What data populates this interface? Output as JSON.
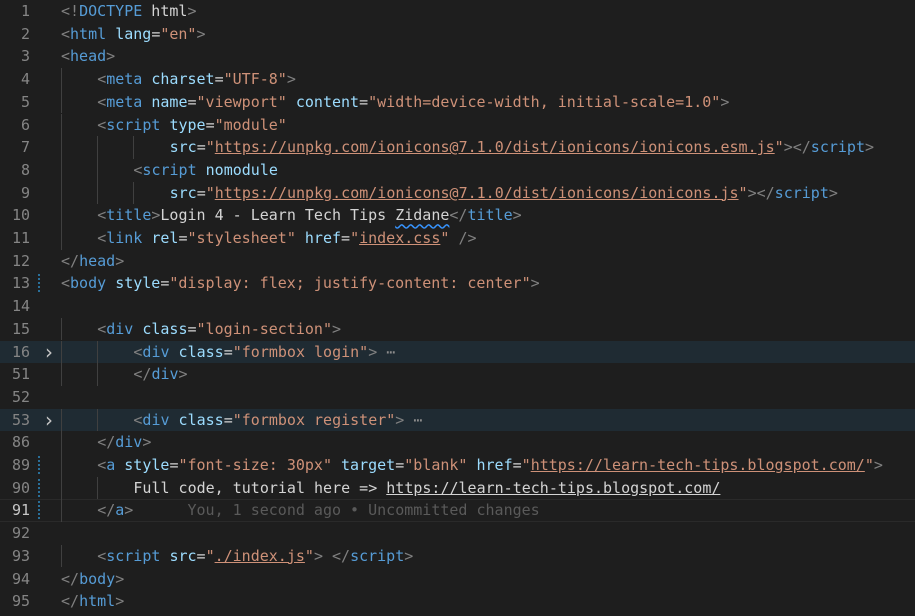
{
  "editor": {
    "lines": [
      {
        "n": "1",
        "indent": 0,
        "tokens": [
          [
            "bracket",
            "<!"
          ],
          [
            "tag",
            "DOCTYPE"
          ],
          [
            "text",
            " html"
          ],
          [
            "bracket",
            ">"
          ]
        ]
      },
      {
        "n": "2",
        "indent": 0,
        "tokens": [
          [
            "bracket",
            "<"
          ],
          [
            "tag",
            "html"
          ],
          [
            "text",
            " "
          ],
          [
            "attr",
            "lang"
          ],
          [
            "text",
            "="
          ],
          [
            "str",
            "\"en\""
          ],
          [
            "bracket",
            ">"
          ]
        ]
      },
      {
        "n": "3",
        "indent": 0,
        "tokens": [
          [
            "bracket",
            "<"
          ],
          [
            "tag",
            "head"
          ],
          [
            "bracket",
            ">"
          ]
        ]
      },
      {
        "n": "4",
        "indent": 1,
        "tokens": [
          [
            "bracket",
            "<"
          ],
          [
            "tag",
            "meta"
          ],
          [
            "text",
            " "
          ],
          [
            "attr",
            "charset"
          ],
          [
            "text",
            "="
          ],
          [
            "str",
            "\"UTF-8\""
          ],
          [
            "bracket",
            ">"
          ]
        ]
      },
      {
        "n": "5",
        "indent": 1,
        "tokens": [
          [
            "bracket",
            "<"
          ],
          [
            "tag",
            "meta"
          ],
          [
            "text",
            " "
          ],
          [
            "attr",
            "name"
          ],
          [
            "text",
            "="
          ],
          [
            "str",
            "\"viewport\""
          ],
          [
            "text",
            " "
          ],
          [
            "attr",
            "content"
          ],
          [
            "text",
            "="
          ],
          [
            "str",
            "\"width=device-width, initial-scale=1.0\""
          ],
          [
            "bracket",
            ">"
          ]
        ]
      },
      {
        "n": "6",
        "indent": 1,
        "tokens": [
          [
            "bracket",
            "<"
          ],
          [
            "tag",
            "script"
          ],
          [
            "text",
            " "
          ],
          [
            "attr",
            "type"
          ],
          [
            "text",
            "="
          ],
          [
            "str",
            "\"module\""
          ]
        ]
      },
      {
        "n": "7",
        "indent": 3,
        "tokens": [
          [
            "attr",
            "src"
          ],
          [
            "text",
            "="
          ],
          [
            "str",
            "\""
          ],
          [
            "str-link",
            "https://unpkg.com/ionicons@7.1.0/dist/ionicons/ionicons.esm.js"
          ],
          [
            "str",
            "\""
          ],
          [
            "bracket",
            "></"
          ],
          [
            "tag",
            "script"
          ],
          [
            "bracket",
            ">"
          ]
        ]
      },
      {
        "n": "8",
        "indent": 2,
        "tokens": [
          [
            "bracket",
            "<"
          ],
          [
            "tag",
            "script"
          ],
          [
            "text",
            " "
          ],
          [
            "attr",
            "nomodule"
          ]
        ]
      },
      {
        "n": "9",
        "indent": 3,
        "tokens": [
          [
            "attr",
            "src"
          ],
          [
            "text",
            "="
          ],
          [
            "str",
            "\""
          ],
          [
            "str-link",
            "https://unpkg.com/ionicons@7.1.0/dist/ionicons/ionicons.js"
          ],
          [
            "str",
            "\""
          ],
          [
            "bracket",
            "></"
          ],
          [
            "tag",
            "script"
          ],
          [
            "bracket",
            ">"
          ]
        ]
      },
      {
        "n": "10",
        "indent": 1,
        "tokens": [
          [
            "bracket",
            "<"
          ],
          [
            "tag",
            "title"
          ],
          [
            "bracket",
            ">"
          ],
          [
            "text",
            "Login 4 - Learn Tech Tips "
          ],
          [
            "text-squiggle",
            "Zidane"
          ],
          [
            "bracket",
            "</"
          ],
          [
            "tag",
            "title"
          ],
          [
            "bracket",
            ">"
          ]
        ]
      },
      {
        "n": "11",
        "indent": 1,
        "tokens": [
          [
            "bracket",
            "<"
          ],
          [
            "tag",
            "link"
          ],
          [
            "text",
            " "
          ],
          [
            "attr",
            "rel"
          ],
          [
            "text",
            "="
          ],
          [
            "str",
            "\"stylesheet\""
          ],
          [
            "text",
            " "
          ],
          [
            "attr",
            "href"
          ],
          [
            "text",
            "="
          ],
          [
            "str",
            "\""
          ],
          [
            "str-link",
            "index.css"
          ],
          [
            "str",
            "\""
          ],
          [
            "text",
            " "
          ],
          [
            "bracket",
            "/>"
          ]
        ]
      },
      {
        "n": "12",
        "indent": 0,
        "tokens": [
          [
            "bracket",
            "</"
          ],
          [
            "tag",
            "head"
          ],
          [
            "bracket",
            ">"
          ]
        ]
      },
      {
        "n": "13",
        "indent": 0,
        "tokens": [
          [
            "bracket",
            "<"
          ],
          [
            "tag",
            "body"
          ],
          [
            "text",
            " "
          ],
          [
            "attr",
            "style"
          ],
          [
            "text",
            "="
          ],
          [
            "str",
            "\"display: flex; justify-content: center\""
          ],
          [
            "bracket",
            ">"
          ]
        ]
      },
      {
        "n": "14",
        "indent": 0,
        "tokens": []
      },
      {
        "n": "15",
        "indent": 1,
        "tokens": [
          [
            "bracket",
            "<"
          ],
          [
            "tag",
            "div"
          ],
          [
            "text",
            " "
          ],
          [
            "attr",
            "class"
          ],
          [
            "text",
            "="
          ],
          [
            "str",
            "\"login-section\""
          ],
          [
            "bracket",
            ">"
          ]
        ]
      },
      {
        "n": "16",
        "indent": 2,
        "tokens": [
          [
            "bracket",
            "<"
          ],
          [
            "tag",
            "div"
          ],
          [
            "text",
            " "
          ],
          [
            "attr",
            "class"
          ],
          [
            "text",
            "="
          ],
          [
            "str",
            "\"formbox login\""
          ],
          [
            "bracket",
            ">"
          ],
          [
            "fold",
            " ⋯"
          ]
        ]
      },
      {
        "n": "51",
        "indent": 2,
        "tokens": [
          [
            "bracket",
            "</"
          ],
          [
            "tag",
            "div"
          ],
          [
            "bracket",
            ">"
          ]
        ]
      },
      {
        "n": "52",
        "indent": 0,
        "tokens": []
      },
      {
        "n": "53",
        "indent": 2,
        "tokens": [
          [
            "bracket",
            "<"
          ],
          [
            "tag",
            "div"
          ],
          [
            "text",
            " "
          ],
          [
            "attr",
            "class"
          ],
          [
            "text",
            "="
          ],
          [
            "str",
            "\"formbox register\""
          ],
          [
            "bracket",
            ">"
          ],
          [
            "fold",
            " ⋯"
          ]
        ]
      },
      {
        "n": "86",
        "indent": 1,
        "tokens": [
          [
            "bracket",
            "</"
          ],
          [
            "tag",
            "div"
          ],
          [
            "bracket",
            ">"
          ]
        ]
      },
      {
        "n": "89",
        "indent": 1,
        "tokens": [
          [
            "bracket",
            "<"
          ],
          [
            "tag",
            "a"
          ],
          [
            "text",
            " "
          ],
          [
            "attr",
            "style"
          ],
          [
            "text",
            "="
          ],
          [
            "str",
            "\"font-size: 30px\""
          ],
          [
            "text",
            " "
          ],
          [
            "attr",
            "target"
          ],
          [
            "text",
            "="
          ],
          [
            "str",
            "\"blank\""
          ],
          [
            "text",
            " "
          ],
          [
            "attr",
            "href"
          ],
          [
            "text",
            "="
          ],
          [
            "str",
            "\""
          ],
          [
            "str-link",
            "https://learn-tech-tips.blogspot.com/"
          ],
          [
            "str",
            "\""
          ],
          [
            "bracket",
            ">"
          ]
        ]
      },
      {
        "n": "90",
        "indent": 2,
        "tokens": [
          [
            "text",
            "Full code, tutorial here => "
          ],
          [
            "text-link",
            "https://learn-tech-tips.blogspot.com/"
          ]
        ]
      },
      {
        "n": "91",
        "indent": 1,
        "tokens": [
          [
            "bracket",
            "</"
          ],
          [
            "tag",
            "a"
          ],
          [
            "bracket",
            ">"
          ],
          [
            "text",
            "    "
          ],
          [
            "blame",
            "  You, 1 second ago • Uncommitted changes"
          ]
        ]
      },
      {
        "n": "92",
        "indent": 0,
        "tokens": []
      },
      {
        "n": "93",
        "indent": 1,
        "tokens": [
          [
            "bracket",
            "<"
          ],
          [
            "tag",
            "script"
          ],
          [
            "text",
            " "
          ],
          [
            "attr",
            "src"
          ],
          [
            "text",
            "="
          ],
          [
            "str",
            "\""
          ],
          [
            "str-link",
            "./index.js"
          ],
          [
            "str",
            "\""
          ],
          [
            "bracket",
            ">"
          ],
          [
            "text",
            " "
          ],
          [
            "bracket",
            "</"
          ],
          [
            "tag",
            "script"
          ],
          [
            "bracket",
            ">"
          ]
        ]
      },
      {
        "n": "94",
        "indent": 0,
        "tokens": [
          [
            "bracket",
            "</"
          ],
          [
            "tag",
            "body"
          ],
          [
            "bracket",
            ">"
          ]
        ]
      },
      {
        "n": "95",
        "indent": 0,
        "tokens": [
          [
            "bracket",
            "</"
          ],
          [
            "tag",
            "html"
          ],
          [
            "bracket",
            ">"
          ]
        ]
      }
    ],
    "folded_lines": [
      "16",
      "53"
    ],
    "highlighted_lines": [
      "16",
      "53"
    ],
    "current_line": "91",
    "git_modified_lines": [
      "13",
      "89",
      "90",
      "91"
    ],
    "colors": {
      "background": "#1e1e1e",
      "tag": "#569cd6",
      "attribute": "#9cdcfe",
      "string": "#ce9178",
      "bracket": "#808080",
      "text": "#d4d4d4",
      "blame": "#5a5a5a",
      "line_number": "#858585"
    },
    "icons": {
      "fold": "chevron-right-icon"
    }
  }
}
